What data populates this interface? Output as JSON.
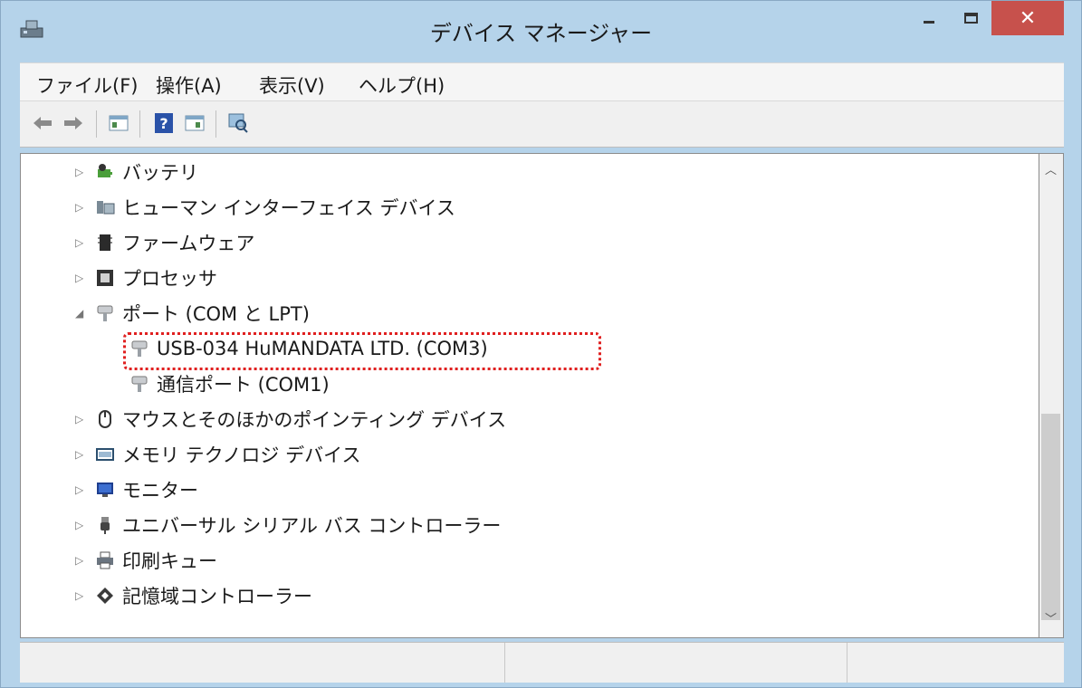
{
  "window": {
    "title": "デバイス マネージャー",
    "close_glyph": "✕"
  },
  "menu": [
    "ファイル(F)",
    "操作(A)",
    "表示(V)",
    "ヘルプ(H)"
  ],
  "toolbar": {
    "icons": [
      "back-arrow-icon",
      "forward-arrow-icon",
      "properties-icon",
      "help-icon",
      "update-driver-icon",
      "scan-hardware-icon"
    ]
  },
  "tree": {
    "nodes": [
      {
        "label": "バッテリ",
        "icon": "battery-icon",
        "expanded": false
      },
      {
        "label": "ヒューマン インターフェイス デバイス",
        "icon": "hid-icon",
        "expanded": false
      },
      {
        "label": "ファームウェア",
        "icon": "firmware-icon",
        "expanded": false
      },
      {
        "label": "プロセッサ",
        "icon": "processor-icon",
        "expanded": false
      },
      {
        "label": "ポート (COM と LPT)",
        "icon": "port-icon",
        "expanded": true,
        "children": [
          {
            "label": "USB-034 HuMANDATA LTD. (COM3)",
            "icon": "port-icon",
            "highlighted": true
          },
          {
            "label": "通信ポート (COM1)",
            "icon": "port-icon"
          }
        ]
      },
      {
        "label": "マウスとそのほかのポインティング デバイス",
        "icon": "mouse-icon",
        "expanded": false
      },
      {
        "label": "メモリ テクノロジ デバイス",
        "icon": "memory-icon",
        "expanded": false
      },
      {
        "label": "モニター",
        "icon": "monitor-icon",
        "expanded": false
      },
      {
        "label": "ユニバーサル シリアル バス コントローラー",
        "icon": "usb-icon",
        "expanded": false
      },
      {
        "label": "印刷キュー",
        "icon": "printer-icon",
        "expanded": false
      },
      {
        "label": "記憶域コントローラー",
        "icon": "storage-controller-icon",
        "expanded": false
      }
    ]
  },
  "colors": {
    "close_button": "#c7514c",
    "highlight_border": "#e02020",
    "frame": "#b5d3ea"
  }
}
